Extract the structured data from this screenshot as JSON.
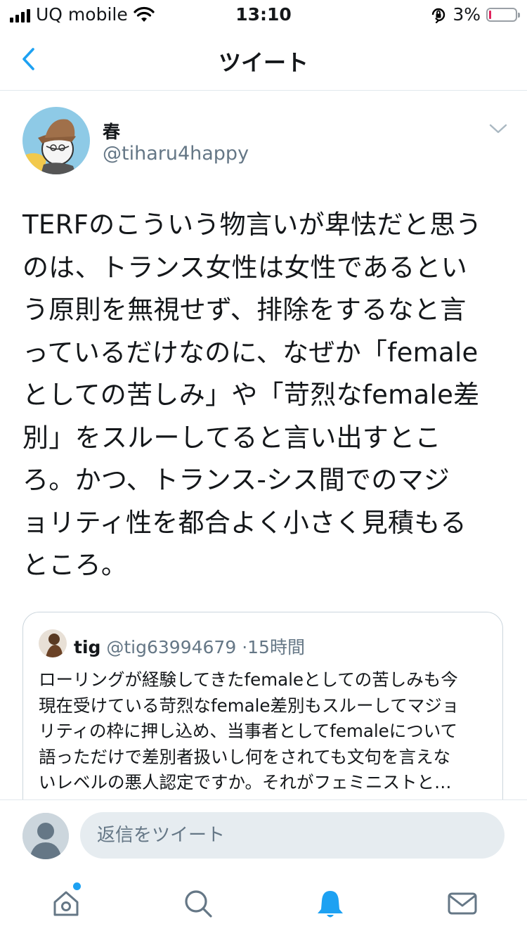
{
  "status_bar": {
    "carrier": "UQ mobile",
    "time": "13:10",
    "battery": "3%",
    "battery_level": 0.03,
    "battery_color": "#e0245e"
  },
  "nav": {
    "back_icon": "chevron-left-icon",
    "title": "ツイート",
    "accent": "#1da1f2"
  },
  "tweet": {
    "name": "春",
    "handle": "@tiharu4happy",
    "text": "TERFのこういう物言いが卑怯だと思う\nのは、トランス女性は女性であるとい\nう原則を無視せず、排除をするなと言\nっているだけなのに、なぜか「female\nとしての苦しみ」や「苛烈なfemale差\n別」をスルーしてると言い出すとこ\nろ。かつ、トランス-シス間でのマジ\nョリティ性を都合よく小さく見積もる\nところ。"
  },
  "quote": {
    "name": "tig",
    "handle": "@tig63994679",
    "separator": "·",
    "time": "15時間",
    "text": "ローリングが経験してきたfemaleとしての苦しみも今\n現在受けている苛烈なfemale差別もスルーしてマジョ\nリティの枠に押し込め、当事者としてfemaleについて\n語っただけで差別者扱いし何をされても文句を言えな\nいレベルの悪人認定ですか。それがフェミニストと…"
  },
  "reply": {
    "placeholder": "返信をツイート"
  },
  "tab_bar": {
    "items": [
      "home-icon",
      "search-icon",
      "notifications-icon",
      "messages-icon"
    ],
    "active": "notifications-icon",
    "active_color": "#1da1f2",
    "inactive_color": "#657786"
  }
}
